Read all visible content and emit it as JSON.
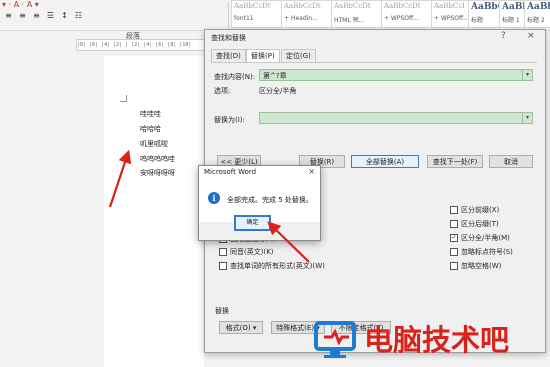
{
  "ribbon": {
    "format_glyphs": [
      "≡",
      "≡",
      "≡",
      "☰",
      "↕",
      "☷"
    ],
    "left_glyphs": "▾ · A · A ▾",
    "group_label": "段落",
    "styles": [
      {
        "sample": "AaBbCcDt",
        "name": "font11"
      },
      {
        "sample": "AaBbCcDt",
        "name": "+ Headin..."
      },
      {
        "sample": "AaBbCcDt",
        "name": "HTML 预..."
      },
      {
        "sample": "AaBbCcDt",
        "name": "+ WPSOff..."
      },
      {
        "sample": "AaBbCcI",
        "name": "+ WPSOff..."
      },
      {
        "sample": "AaBbC",
        "name": "标题"
      },
      {
        "sample": "AaBbC",
        "name": "标题 1"
      },
      {
        "sample": "AaBbC",
        "name": "标题 2"
      }
    ]
  },
  "ruler": {
    "text": "|8| |6| |4| |2| | |2| |4| |6| |8| |10|"
  },
  "document": {
    "lines": [
      "哇哇哇",
      "哈哈哈",
      "叽里呱啦",
      "呜呜呜呜哇",
      "安呀呀呀呀"
    ]
  },
  "find_replace": {
    "title": "查找和替换",
    "help": "?",
    "close": "×",
    "tabs": [
      {
        "label": "查找(D)",
        "active": false
      },
      {
        "label": "替换(P)",
        "active": true
      },
      {
        "label": "定位(G)",
        "active": false
      }
    ],
    "find_label": "查找内容(N):",
    "find_value": "第^?章",
    "options_label": "选项:",
    "options_value": "区分全/半角",
    "replace_label": "替换为(I):",
    "replace_value": "",
    "buttons": {
      "less": "<< 更少(L)",
      "replace": "替换(R)",
      "replace_all": "全部替换(A)",
      "find_next": "查找下一处(F)",
      "cancel": "取消"
    },
    "left_checks": [
      {
        "label": "使用通配符(U)",
        "checked": false
      },
      {
        "label": "同音(英文)(K)",
        "checked": false
      },
      {
        "label": "查找单词的所有形式(英文)(W)",
        "checked": false
      }
    ],
    "right_checks": [
      {
        "label": "区分前缀(X)",
        "checked": false
      },
      {
        "label": "区分后缀(T)",
        "checked": false
      },
      {
        "label": "区分全/半角(M)",
        "checked": true
      },
      {
        "label": "忽略标点符号(S)",
        "checked": false
      },
      {
        "label": "忽略空格(W)",
        "checked": false
      }
    ],
    "replace_section": "替换",
    "format_btn": "格式(O) ▾",
    "special_btn": "特殊格式(E) ▾",
    "noformat_btn": "不限定格式(T)"
  },
  "message_box": {
    "title": "Microsoft Word",
    "close": "×",
    "icon": "i",
    "text": "全部完成。完成 5 处替换。",
    "ok": "确定"
  },
  "watermark": {
    "text": "电脑技术吧"
  },
  "colors": {
    "accent_blue": "#2e7bcf",
    "arrow_red": "#d9221c",
    "combo_green": "#cde8cf"
  }
}
